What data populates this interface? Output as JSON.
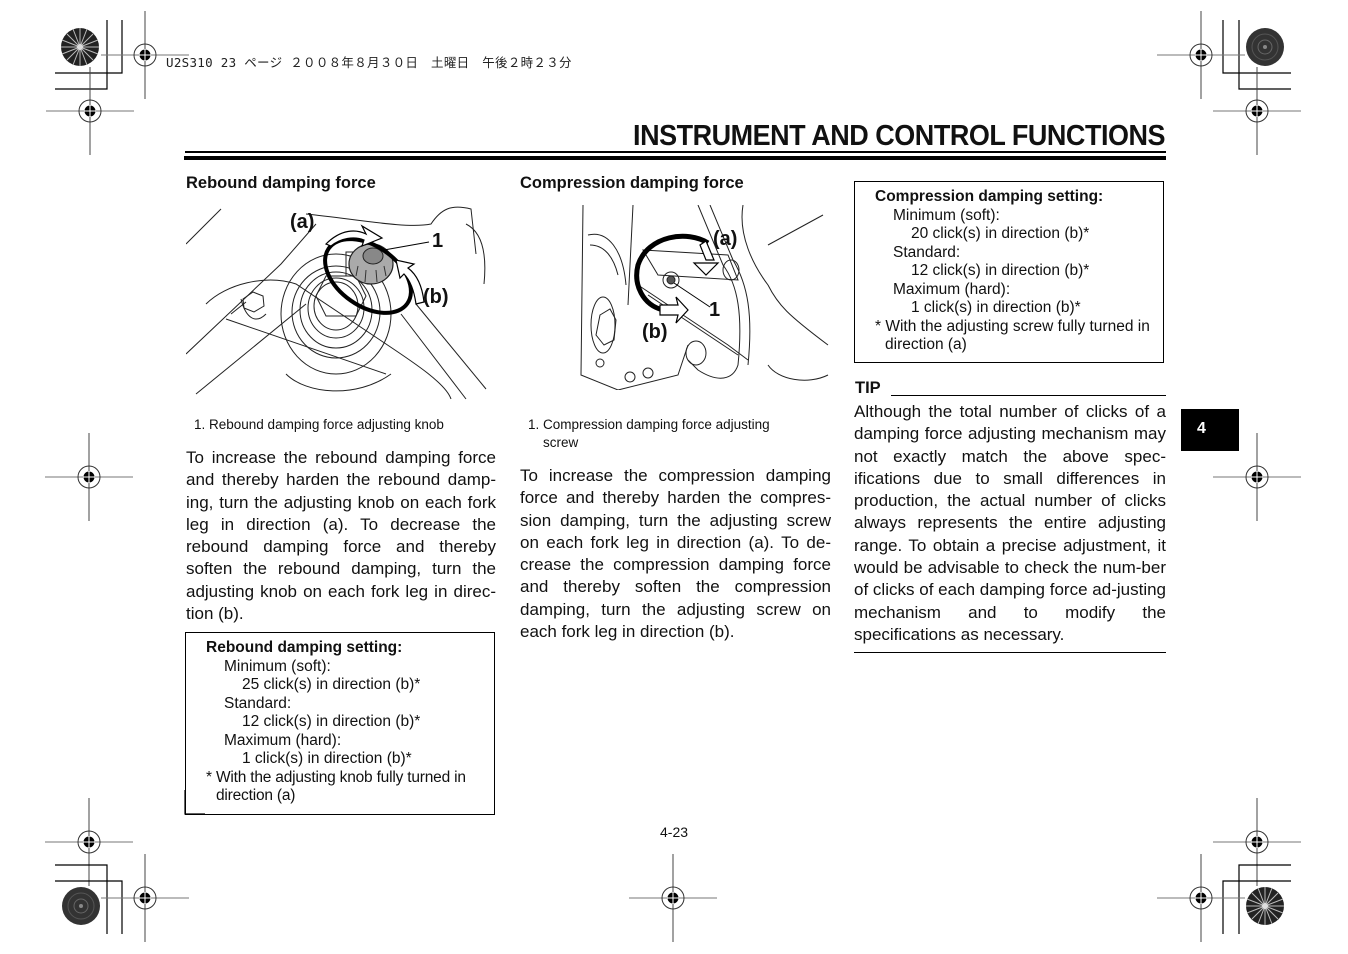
{
  "print_header": "U2S310 23 ページ ２００８年８月３０日　土曜日　午後２時２３分",
  "page": {
    "title": "INSTRUMENT AND CONTROL FUNCTIONS",
    "chapter_tab": "4",
    "page_number": "4-23"
  },
  "rebound": {
    "heading": "Rebound damping force",
    "figure": {
      "label_a": "(a)",
      "label_b": "(b)",
      "label_1": "1"
    },
    "caption": "1. Rebound damping force adjusting knob",
    "body": "To increase the rebound damping force and thereby harden the rebound damp-ing, turn the adjusting knob on each fork leg in direction (a). To decrease the rebound damping force and thereby soften the rebound damping, turn the adjusting knob on each fork leg in direc-tion (b).",
    "setting": {
      "title": "Rebound damping setting:",
      "min_label": "Minimum (soft):",
      "min_value": "25 click(s) in direction (b)*",
      "std_label": "Standard:",
      "std_value": "12 click(s) in direction (b)*",
      "max_label": "Maximum (hard):",
      "max_value": "1 click(s) in direction (b)*",
      "note": "* With the adjusting knob fully turned in direction (a)"
    }
  },
  "compression": {
    "heading": "Compression damping force",
    "figure": {
      "label_a": "(a)",
      "label_b": "(b)",
      "label_1": "1"
    },
    "caption_line1": "1. Compression damping force adjusting",
    "caption_line2": "screw",
    "body": "To increase the compression damping force and thereby harden the compres-sion damping, turn the adjusting screw on each fork leg in direction (a). To de-crease the compression damping force and thereby soften the compression damping, turn the adjusting screw on each fork leg in direction (b).",
    "setting": {
      "title": "Compression damping setting:",
      "min_label": "Minimum (soft):",
      "min_value": "20 click(s) in direction (b)*",
      "std_label": "Standard:",
      "std_value": "12 click(s) in direction (b)*",
      "max_label": "Maximum (hard):",
      "max_value": "1 click(s) in direction (b)*",
      "note": "* With the adjusting screw fully turned in direction (a)"
    }
  },
  "tip": {
    "label": "TIP",
    "body": "Although the total number of clicks of a damping force adjusting mechanism may not exactly match the above spec-ifications due to small differences in production, the actual number of clicks always represents the entire adjusting range. To obtain a precise adjustment, it would be advisable to check the num-ber of clicks of each damping force ad-justing mechanism and to modify the specifications as necessary."
  }
}
